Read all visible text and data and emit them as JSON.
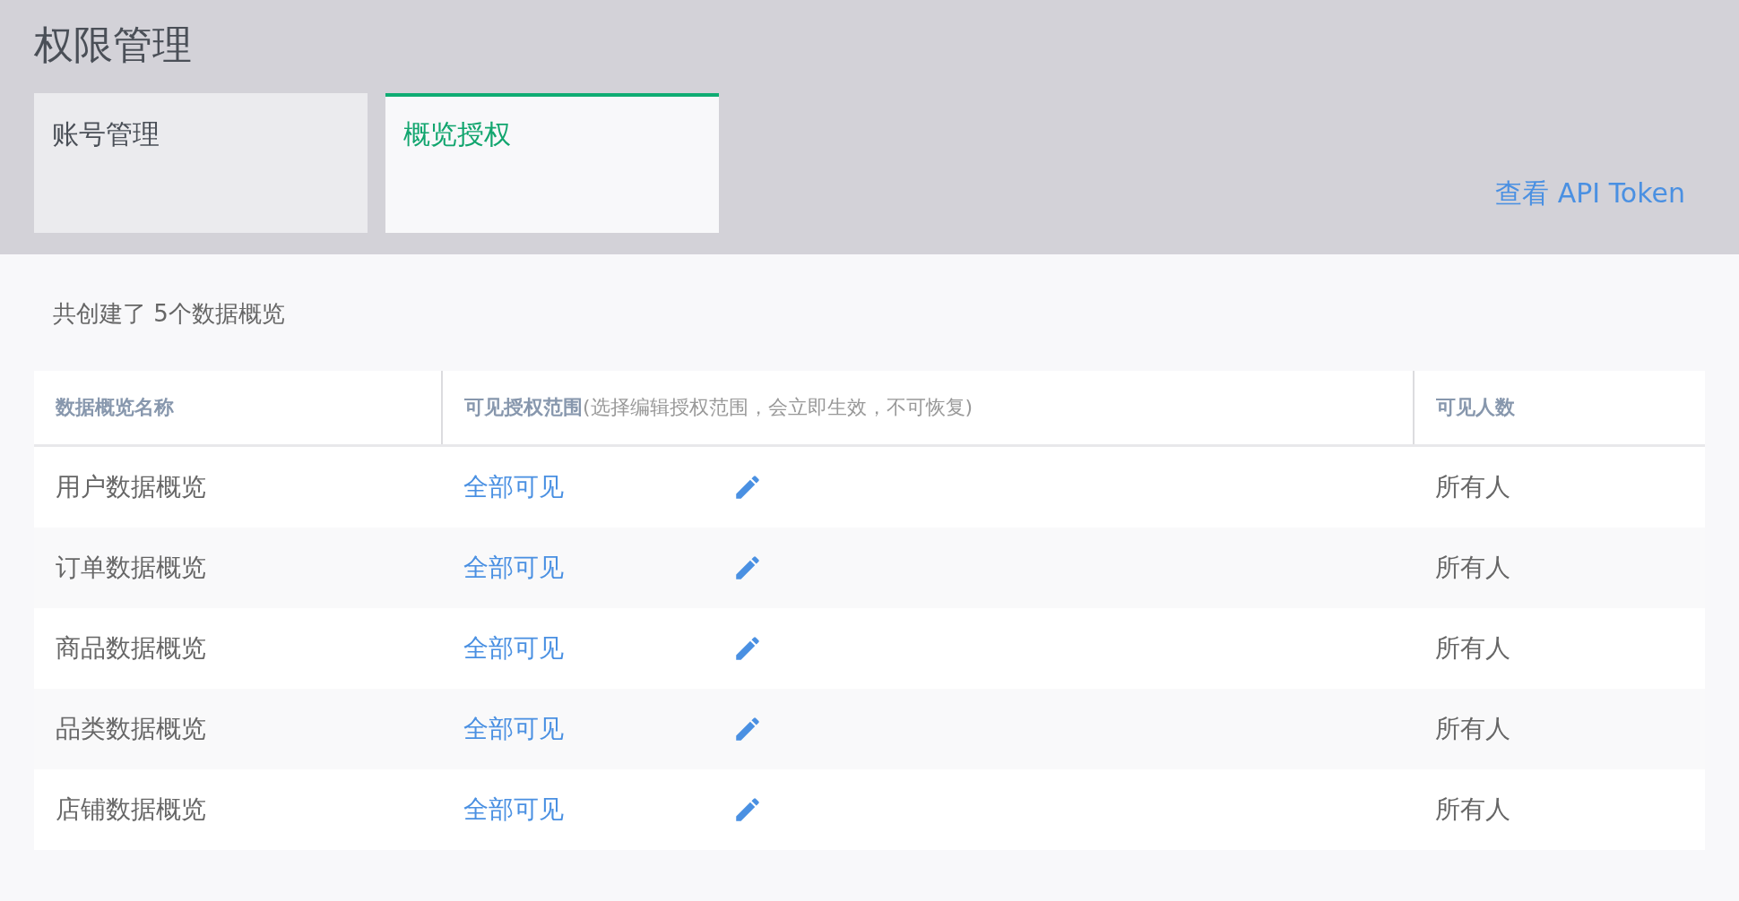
{
  "page": {
    "title": "权限管理"
  },
  "tabs": [
    {
      "label": "账号管理",
      "selected": false
    },
    {
      "label": "概览授权",
      "selected": true
    }
  ],
  "api_link": "查看 API Token",
  "summary": "共创建了 5个数据概览",
  "table": {
    "columns": [
      "数据概览名称",
      "**可见授权范围**(选择编辑授权范围，会立即生效，不可恢复)",
      "可见人数"
    ],
    "rows": [
      {
        "name": "用户数据概览",
        "scope": "全部可见",
        "viewers": "所有人"
      },
      {
        "name": "订单数据概览",
        "scope": "全部可见",
        "viewers": "所有人"
      },
      {
        "name": "商品数据概览",
        "scope": "全部可见",
        "viewers": "所有人"
      },
      {
        "name": "品类数据概览",
        "scope": "全部可见",
        "viewers": "所有人"
      },
      {
        "name": "店铺数据概览",
        "scope": "全部可见",
        "viewers": "所有人"
      }
    ]
  }
}
